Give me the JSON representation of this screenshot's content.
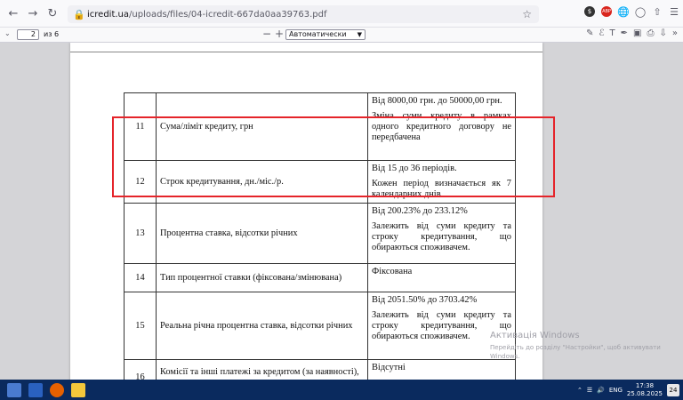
{
  "browser": {
    "url_domain": "icredit.ua",
    "url_path": "/uploads/files/04-icredit-667da0aa39763.pdf",
    "lock_icon": "shield-lock-icon",
    "bookmark_icon": "star-icon",
    "ext_badge_1": "$",
    "ext_badge_2": "ABP"
  },
  "pdf_toolbar": {
    "page_number": "2",
    "page_of": "из 6",
    "zoom_out": "−",
    "zoom_in": "+",
    "zoom_value": "Автоматически"
  },
  "table": {
    "rows": [
      {
        "num": "11",
        "label": "Сума/ліміт кредиту, грн",
        "desc": [
          "Від 8000,00 грн. до 50000,00 грн.",
          "Зміна суми кредиту в рамках одного кредитного договору не передбачена"
        ]
      },
      {
        "num": "12",
        "label": "Строк кредитування, дн./міс./р.",
        "desc": [
          "Від 15 до 36 періодів.",
          "Кожен період визначається як 7 календарних днів"
        ]
      },
      {
        "num": "13",
        "label": "Процентна ставка, відсотки річних",
        "desc": [
          "Від 200.23% до 233.12%",
          "Залежить від суми кредиту та строку кредитування, що обираються споживачем."
        ]
      },
      {
        "num": "14",
        "label": "Тип процентної ставки (фіксована/змінювана)",
        "desc": [
          "Фіксована"
        ]
      },
      {
        "num": "15",
        "label": "Реальна річна процентна ставка, відсотки річних",
        "desc": [
          "Від 2051.50% до 3703.42%",
          "Залежить від суми кредиту та строку кредитування, що обираються споживачем."
        ]
      },
      {
        "num": "16",
        "label": "Комісії та інші платежі за кредитом (за наявності), грн",
        "desc": [
          "Відсутні"
        ]
      }
    ]
  },
  "watermark": {
    "title": "Активація Windows",
    "subtitle": "Перейдіть до розділу \"Настройки\", щоб активувати Windows."
  },
  "taskbar": {
    "time": "17:38",
    "date": "25.08.2025",
    "lang": "ENG",
    "notif_count": "24"
  },
  "colors": {
    "highlight": "#e5242a",
    "taskbar": "#0a2a5e"
  }
}
